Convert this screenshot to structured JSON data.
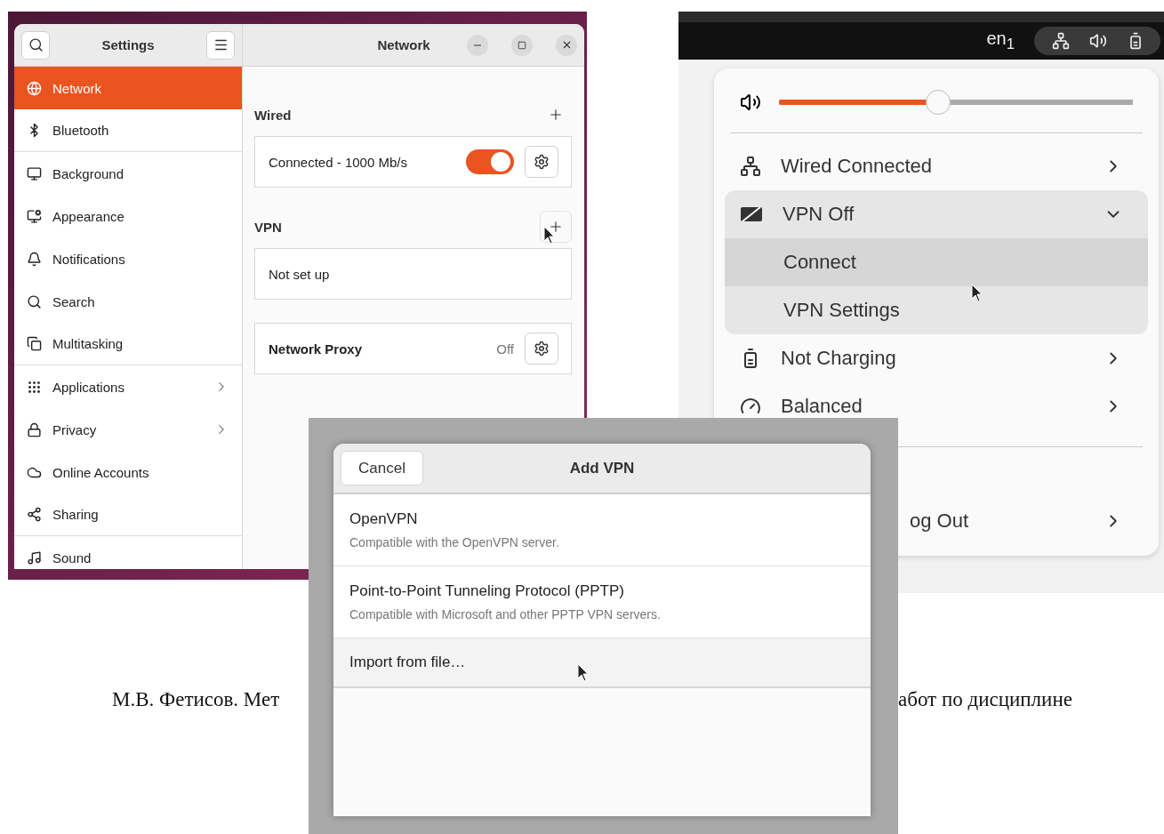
{
  "settings_window": {
    "sidebar_title": "Settings",
    "title": "Network",
    "sidebar_items": [
      {
        "label": "Network",
        "selected": true,
        "has_submenu": false
      },
      {
        "label": "Bluetooth",
        "selected": false,
        "has_submenu": false
      },
      {
        "label": "Background",
        "selected": false,
        "has_submenu": false
      },
      {
        "label": "Appearance",
        "selected": false,
        "has_submenu": false
      },
      {
        "label": "Notifications",
        "selected": false,
        "has_submenu": false
      },
      {
        "label": "Search",
        "selected": false,
        "has_submenu": false
      },
      {
        "label": "Multitasking",
        "selected": false,
        "has_submenu": false
      },
      {
        "label": "Applications",
        "selected": false,
        "has_submenu": true
      },
      {
        "label": "Privacy",
        "selected": false,
        "has_submenu": true
      },
      {
        "label": "Online Accounts",
        "selected": false,
        "has_submenu": false
      },
      {
        "label": "Sharing",
        "selected": false,
        "has_submenu": false
      },
      {
        "label": "Sound",
        "selected": false,
        "has_submenu": false
      }
    ],
    "wired": {
      "heading": "Wired",
      "connection": "Connected - 1000 Mb/s",
      "on": true
    },
    "vpn": {
      "heading": "VPN",
      "status": "Not set up"
    },
    "proxy": {
      "label": "Network Proxy",
      "value": "Off"
    }
  },
  "quick_settings": {
    "keyboard_layout": "en$_{1}$",
    "volume": {
      "level": 0.45
    },
    "items": [
      {
        "kind": "row",
        "label": "Wired Connected"
      },
      {
        "kind": "expander",
        "label": "VPN Off",
        "expanded": true,
        "children": [
          {
            "label": "Connect",
            "selected": true
          },
          {
            "label": "VPN Settings",
            "selected": false
          }
        ]
      },
      {
        "kind": "row",
        "label": "Not Charging"
      },
      {
        "kind": "row",
        "label": "Balanced"
      },
      {
        "kind": "divider"
      },
      {
        "kind": "covered_row",
        "label": "og Out"
      }
    ]
  },
  "add_vpn_dialog": {
    "cancel": "Cancel",
    "title": "Add VPN",
    "options": [
      {
        "name": "OpenVPN",
        "description": "Compatible with the OpenVPN server.",
        "highlighted": false
      },
      {
        "name": "Point-to-Point Tunneling Protocol (PPTP)",
        "description": "Compatible with Microsoft and other PPTP VPN servers.",
        "highlighted": false
      },
      {
        "name": "Import from file…",
        "highlighted": true
      }
    ]
  },
  "footer": [
    "М.В. Фетисов.  Мет",
    "абот по дисциплине"
  ]
}
